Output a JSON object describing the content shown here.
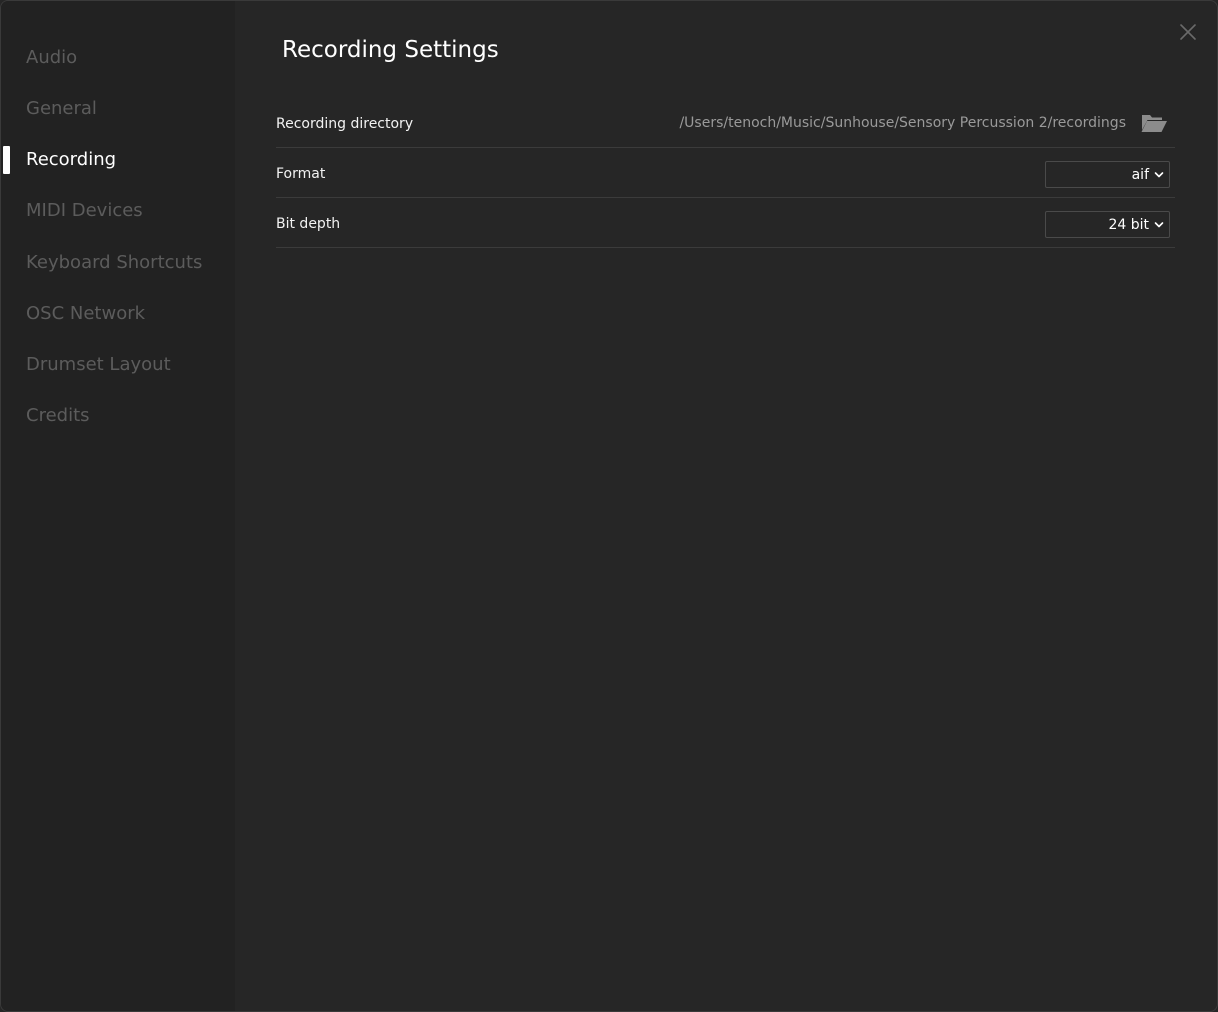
{
  "sidebar": {
    "items": [
      {
        "label": "Audio",
        "active": false
      },
      {
        "label": "General",
        "active": false
      },
      {
        "label": "Recording",
        "active": true
      },
      {
        "label": "MIDI Devices",
        "active": false
      },
      {
        "label": "Keyboard Shortcuts",
        "active": false
      },
      {
        "label": "OSC Network",
        "active": false
      },
      {
        "label": "Drumset Layout",
        "active": false
      },
      {
        "label": "Credits",
        "active": false
      }
    ]
  },
  "header": {
    "title": "Recording Settings",
    "close_icon": "close-icon"
  },
  "settings": {
    "recording_directory": {
      "label": "Recording directory",
      "path": "/Users/tenoch/Music/Sunhouse/Sensory Percussion 2/recordings",
      "icon": "folder-open-icon"
    },
    "format": {
      "label": "Format",
      "value": "aif"
    },
    "bit_depth": {
      "label": "Bit depth",
      "value": "24 bit"
    }
  },
  "colors": {
    "background": "#262626",
    "sidebar": "#222222",
    "text_primary": "#ffffff",
    "text_muted": "#5c5c5c",
    "text_path": "#9a9a9a",
    "divider": "#3b3b3b"
  }
}
